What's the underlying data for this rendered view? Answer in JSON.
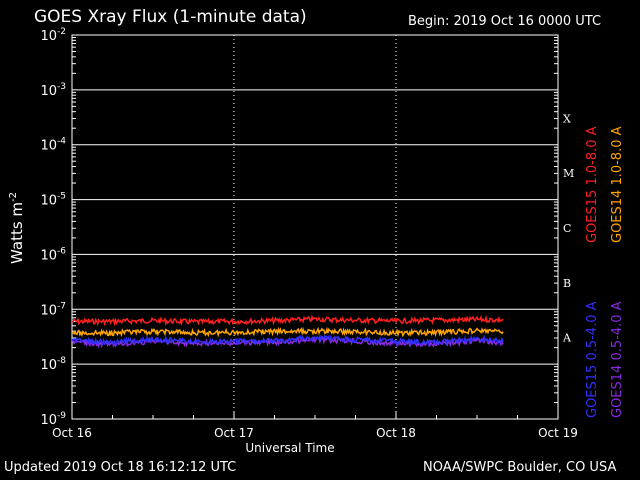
{
  "header": {
    "title": "GOES Xray Flux (1-minute data)",
    "begin": "Begin:  2019 Oct 16 0000 UTC"
  },
  "footer": {
    "updated": "Updated 2019 Oct 18 16:12:12 UTC",
    "credit": "NOAA/SWPC Boulder, CO USA"
  },
  "chart_data": {
    "type": "line",
    "title": "GOES Xray Flux (1-minute data)",
    "xlabel": "Universal Time",
    "ylabel": "Watts m",
    "ylabel_sup": "-2",
    "yscale": "log",
    "ylim": [
      1e-09,
      0.01
    ],
    "xlim": [
      "Oct 16",
      "Oct 19"
    ],
    "x_ticks": [
      "Oct 16",
      "Oct 17",
      "Oct 18",
      "Oct 19"
    ],
    "y_ticks": [
      {
        "value": 0.01,
        "base": "10",
        "exp": "-2"
      },
      {
        "value": 0.001,
        "base": "10",
        "exp": "-3"
      },
      {
        "value": 0.0001,
        "base": "10",
        "exp": "-4"
      },
      {
        "value": 1e-05,
        "base": "10",
        "exp": "-5"
      },
      {
        "value": 1e-06,
        "base": "10",
        "exp": "-6"
      },
      {
        "value": 1e-07,
        "base": "10",
        "exp": "-7"
      },
      {
        "value": 1e-08,
        "base": "10",
        "exp": "-8"
      },
      {
        "value": 1e-09,
        "base": "10",
        "exp": "-9"
      }
    ],
    "flare_classes": [
      {
        "label": "X",
        "value": 0.000316
      },
      {
        "label": "M",
        "value": 3.16e-05
      },
      {
        "label": "C",
        "value": 3.16e-06
      },
      {
        "label": "B",
        "value": 3.16e-07
      },
      {
        "label": "A",
        "value": 3.16e-08
      }
    ],
    "grid": true,
    "series": [
      {
        "name": "GOES15 1.0-8.0 A",
        "color": "#ff2020",
        "x": [
          "2019-10-16 00:00",
          "2019-10-16 06:00",
          "2019-10-16 12:00",
          "2019-10-16 18:00",
          "2019-10-17 00:00",
          "2019-10-17 06:00",
          "2019-10-17 12:00",
          "2019-10-17 18:00",
          "2019-10-18 00:00",
          "2019-10-18 06:00",
          "2019-10-18 12:00",
          "2019-10-18 16:00"
        ],
        "values": [
          6e-08,
          6e-08,
          6.2e-08,
          5.9e-08,
          6e-08,
          6.2e-08,
          6.6e-08,
          6.3e-08,
          6.1e-08,
          6.3e-08,
          6.5e-08,
          6.4e-08
        ]
      },
      {
        "name": "GOES14 1.0-8.0 A",
        "color": "#ffa500",
        "x": [
          "2019-10-16 00:00",
          "2019-10-16 06:00",
          "2019-10-16 12:00",
          "2019-10-16 18:00",
          "2019-10-17 00:00",
          "2019-10-17 06:00",
          "2019-10-17 12:00",
          "2019-10-17 18:00",
          "2019-10-18 00:00",
          "2019-10-18 06:00",
          "2019-10-18 12:00",
          "2019-10-18 16:00"
        ],
        "values": [
          3.7e-08,
          3.7e-08,
          3.9e-08,
          3.7e-08,
          3.8e-08,
          3.9e-08,
          4e-08,
          3.9e-08,
          3.7e-08,
          3.8e-08,
          4.1e-08,
          3.9e-08
        ]
      },
      {
        "name": "GOES15 0.5-4.0 A",
        "color": "#3030ff",
        "x": [
          "2019-10-16 00:00",
          "2019-10-16 06:00",
          "2019-10-16 12:00",
          "2019-10-16 18:00",
          "2019-10-17 00:00",
          "2019-10-17 06:00",
          "2019-10-17 12:00",
          "2019-10-17 18:00",
          "2019-10-18 00:00",
          "2019-10-18 06:00",
          "2019-10-18 12:00",
          "2019-10-18 16:00"
        ],
        "values": [
          2.7e-08,
          2.5e-08,
          2.8e-08,
          2.6e-08,
          2.6e-08,
          2.7e-08,
          3e-08,
          2.8e-08,
          2.6e-08,
          2.5e-08,
          2.9e-08,
          2.6e-08
        ]
      },
      {
        "name": "GOES14 0.5-4.0 A",
        "color": "#8a2be2",
        "x": [
          "2019-10-16 00:00",
          "2019-10-16 06:00",
          "2019-10-16 12:00",
          "2019-10-16 18:00",
          "2019-10-17 00:00",
          "2019-10-17 06:00",
          "2019-10-17 12:00",
          "2019-10-17 18:00",
          "2019-10-18 00:00",
          "2019-10-18 06:00",
          "2019-10-18 12:00",
          "2019-10-18 16:00"
        ],
        "values": [
          2.5e-08,
          2.3e-08,
          2.6e-08,
          2.4e-08,
          2.4e-08,
          2.5e-08,
          2.8e-08,
          2.6e-08,
          2.4e-08,
          2.3e-08,
          2.7e-08,
          2.4e-08
        ]
      }
    ]
  }
}
